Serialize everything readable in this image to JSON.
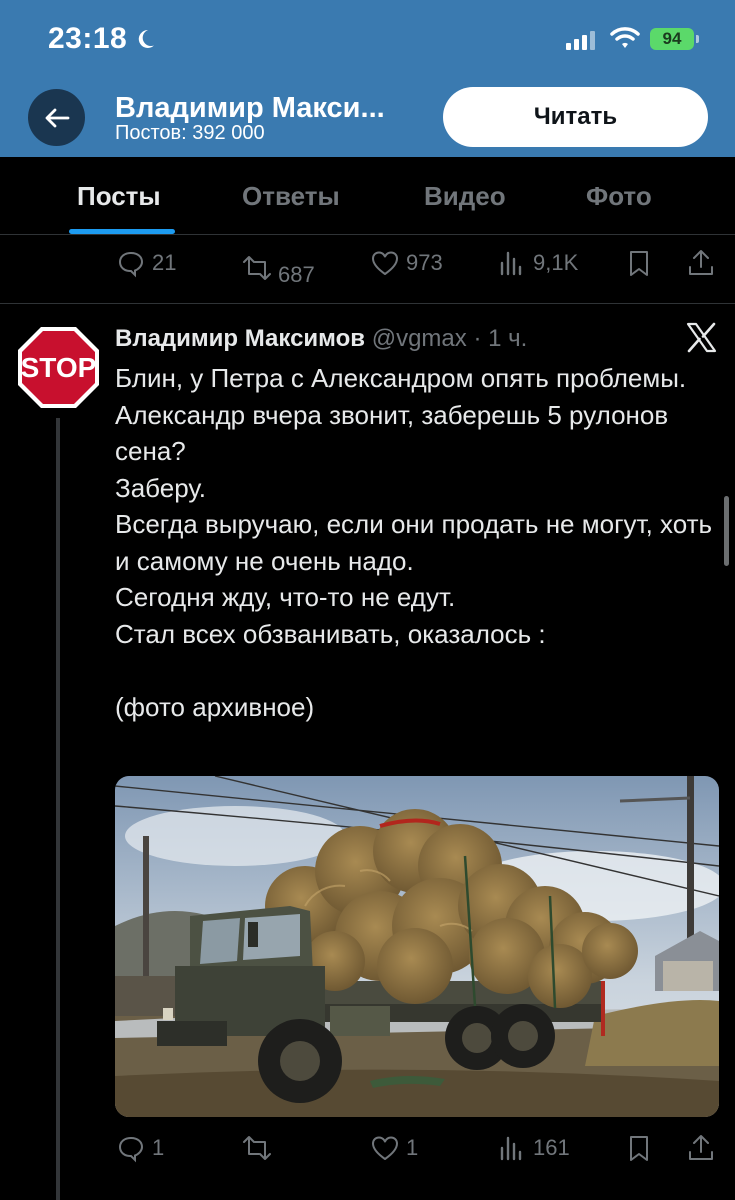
{
  "status_bar": {
    "time": "23:18",
    "battery": "94"
  },
  "header": {
    "profile_name": "Владимир Макси...",
    "post_count": "Постов: 392 000",
    "read_button": "Читать"
  },
  "tabs": [
    {
      "label": "Посты",
      "active": true
    },
    {
      "label": "Ответы",
      "active": false
    },
    {
      "label": "Видео",
      "active": false
    },
    {
      "label": "Фото",
      "active": false
    }
  ],
  "prev_tweet_actions": {
    "replies": "21",
    "reposts": "687",
    "likes": "973",
    "views": "9,1K"
  },
  "tweet": {
    "author": "Владимир Максимов",
    "handle": "@vgmax",
    "separator": "·",
    "time_ago": "1 ч.",
    "avatar_text": "STOP",
    "text": "Блин, у Петра с Александром опять проблемы.\nАлександр вчера звонит, заберешь 5 рулонов сена?\nЗаберу.\nВсегда выручаю, если они продать не могут, хоть и самому не очень надо.\nСегодня жду, что-то не едут.\nСтал всех обзванивать, оказалось :\n\n(фото архивное)",
    "actions": {
      "replies": "1",
      "reposts": "",
      "likes": "1",
      "views": "161"
    }
  },
  "colors": {
    "header_bg": "#3a7ab0",
    "accent": "#1d9bf0",
    "muted": "#71767b"
  }
}
